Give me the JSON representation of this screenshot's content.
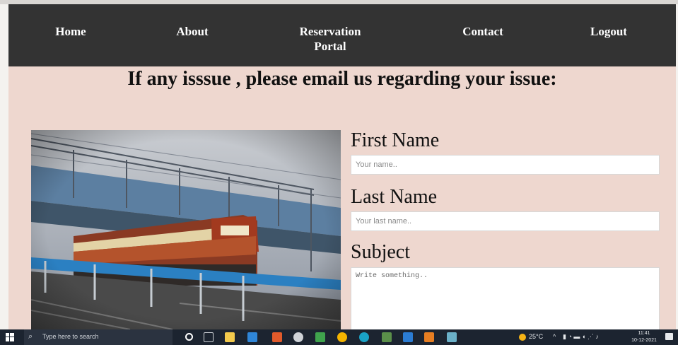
{
  "nav": {
    "home": "Home",
    "about": "About",
    "reservation_line1": "Reservation",
    "reservation_line2": "Portal",
    "contact": "Contact",
    "logout": "Logout"
  },
  "main": {
    "heading": "If any isssue , please email us regarding your issue:"
  },
  "form": {
    "first_name_label": "First Name",
    "first_name_placeholder": "Your name..",
    "last_name_label": "Last Name",
    "last_name_placeholder": "Your last name..",
    "subject_label": "Subject",
    "subject_placeholder": "Write something.."
  },
  "taskbar": {
    "search_placeholder": "Type here to search",
    "weather": "25°C",
    "time": "11:41",
    "date": "10-12-2021"
  },
  "colors": {
    "navbar_bg": "#333333",
    "content_bg": "#eed7cf",
    "taskbar_bg": "#1c2430"
  }
}
